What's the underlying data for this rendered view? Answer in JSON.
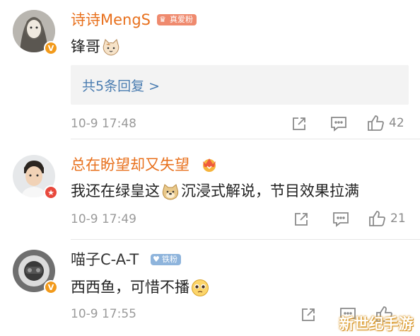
{
  "comments": [
    {
      "username": "诗诗MengS",
      "name_color": "#e8711e",
      "tag": "真爱粉",
      "tag_color": "#ef8a6e",
      "badge_color": "#f29a1b",
      "text": "锋哥",
      "emoji": "cat-face-emoji",
      "reply_link": "共5条回复 >",
      "time": "10-9 17:48",
      "share_icon": "share-icon",
      "comment_icon": "comment-icon",
      "like_icon": "thumbs-up-icon",
      "like_count": "42"
    },
    {
      "username": "总在盼望却又失望",
      "name_color": "#e8711e",
      "badge_color": "#e8483c",
      "text_before": "我还在绿皇这",
      "text_after": "沉浸式解说，节目效果拉满",
      "emoji": "doge-emoji",
      "time": "10-9 17:49",
      "like_count": "21"
    },
    {
      "username": "喵子C-A-T",
      "name_color": "#333333",
      "tag": "铁粉",
      "tag_color": "#8eb4dc",
      "badge_color": "#f29a1b",
      "text": "西西鱼，可惜不播",
      "emoji": "pleading-face-emoji",
      "time": "10-9 17:55"
    }
  ],
  "watermark": "新世纪手游"
}
